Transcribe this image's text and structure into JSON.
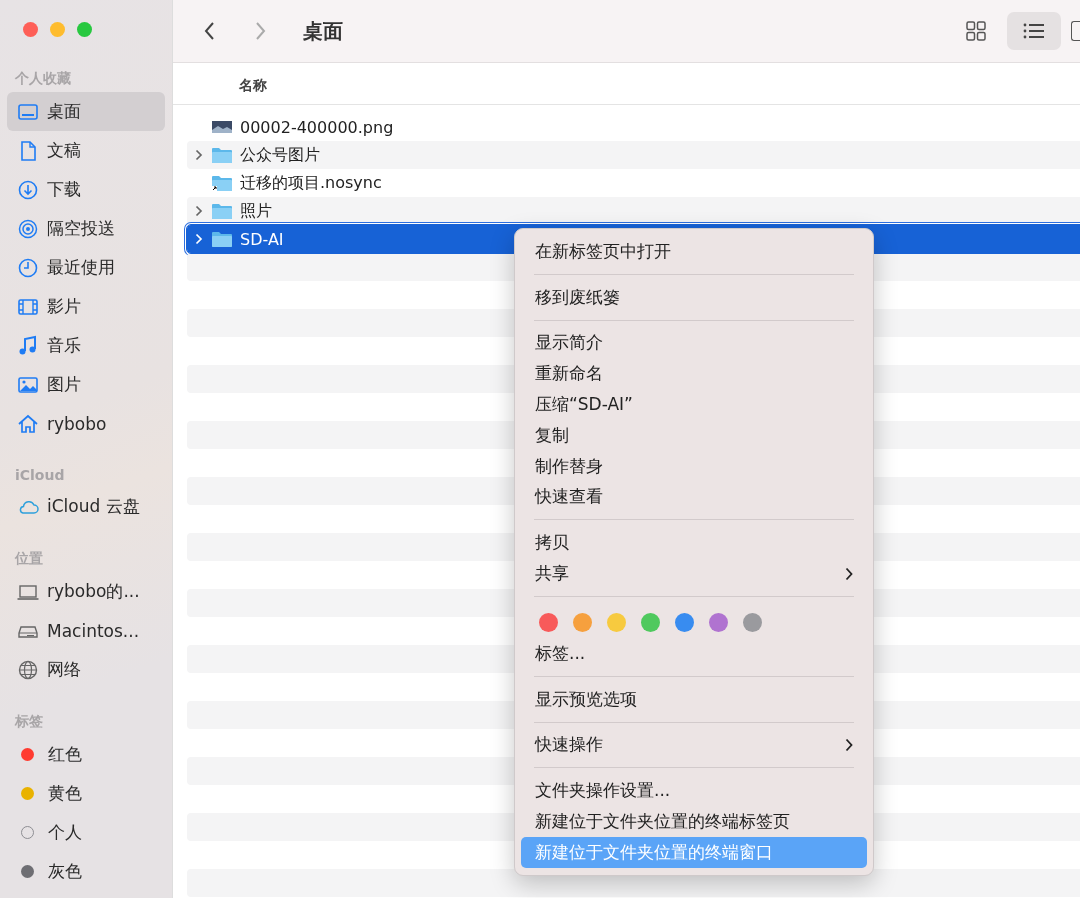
{
  "sidebar": {
    "sections": [
      {
        "title": "个人收藏",
        "items": [
          {
            "label": "桌面",
            "selected": true
          },
          {
            "label": "文稿",
            "selected": false
          },
          {
            "label": "下载",
            "selected": false
          },
          {
            "label": "隔空投送",
            "selected": false
          },
          {
            "label": "最近使用",
            "selected": false
          },
          {
            "label": "影片",
            "selected": false
          },
          {
            "label": "音乐",
            "selected": false
          },
          {
            "label": "图片",
            "selected": false
          },
          {
            "label": "rybobo",
            "selected": false
          }
        ]
      },
      {
        "title": "iCloud",
        "items": [
          {
            "label": "iCloud 云盘",
            "selected": false
          }
        ]
      },
      {
        "title": "位置",
        "items": [
          {
            "label": "rybobo的...",
            "selected": false
          },
          {
            "label": "Macintos...",
            "selected": false
          },
          {
            "label": "网络",
            "selected": false
          }
        ]
      }
    ],
    "tags": {
      "title": "标签",
      "items": [
        {
          "label": "红色",
          "color": "#ff3b30",
          "kind": "filled"
        },
        {
          "label": "黄色",
          "color": "#e9b200",
          "kind": "filled"
        },
        {
          "label": "个人",
          "color": "#8e8e93",
          "kind": "hollow"
        },
        {
          "label": "灰色",
          "color": "#6e6e73",
          "kind": "filled"
        }
      ]
    }
  },
  "toolbar": {
    "title": "桌面",
    "views": [
      {
        "kind": "grid",
        "selected": false
      },
      {
        "kind": "list",
        "selected": true
      }
    ]
  },
  "file_list": {
    "columns": [
      "名称"
    ],
    "rows": [
      {
        "name": "00002-400000.png",
        "kind": "image",
        "expandable": false,
        "selected": false
      },
      {
        "name": "公众号图片",
        "kind": "folder",
        "expandable": true,
        "selected": false
      },
      {
        "name": "迁移的项目.nosync",
        "kind": "alias",
        "expandable": false,
        "selected": false
      },
      {
        "name": "照片",
        "kind": "folder",
        "expandable": true,
        "selected": false
      },
      {
        "name": "SD-AI",
        "kind": "folder",
        "expandable": true,
        "selected": true
      }
    ]
  },
  "context_menu": {
    "items": [
      {
        "kind": "item",
        "label": "在新标签页中打开",
        "submenu": false,
        "selected": false
      },
      {
        "kind": "separator"
      },
      {
        "kind": "item",
        "label": "移到废纸篓",
        "submenu": false,
        "selected": false
      },
      {
        "kind": "separator"
      },
      {
        "kind": "item",
        "label": "显示简介",
        "submenu": false,
        "selected": false
      },
      {
        "kind": "item",
        "label": "重新命名",
        "submenu": false,
        "selected": false
      },
      {
        "kind": "item",
        "label": "压缩“SD-AI”",
        "submenu": false,
        "selected": false
      },
      {
        "kind": "item",
        "label": "复制",
        "submenu": false,
        "selected": false
      },
      {
        "kind": "item",
        "label": "制作替身",
        "submenu": false,
        "selected": false
      },
      {
        "kind": "item",
        "label": "快速查看",
        "submenu": false,
        "selected": false
      },
      {
        "kind": "separator"
      },
      {
        "kind": "item",
        "label": "拷贝",
        "submenu": false,
        "selected": false
      },
      {
        "kind": "item",
        "label": "共享",
        "submenu": true,
        "selected": false
      },
      {
        "kind": "separator"
      },
      {
        "kind": "colors",
        "colors": [
          {
            "color": "#f85a5a"
          },
          {
            "color": "#f6a03e"
          },
          {
            "color": "#f7ca3f"
          },
          {
            "color": "#4fc95e"
          },
          {
            "color": "#388cf0"
          },
          {
            "color": "#b073d0"
          },
          {
            "color": "#9a9a9e"
          }
        ]
      },
      {
        "kind": "item",
        "label": "标签...",
        "submenu": false,
        "selected": false
      },
      {
        "kind": "separator"
      },
      {
        "kind": "item",
        "label": "显示预览选项",
        "submenu": false,
        "selected": false
      },
      {
        "kind": "separator"
      },
      {
        "kind": "item",
        "label": "快速操作",
        "submenu": true,
        "selected": false
      },
      {
        "kind": "separator"
      },
      {
        "kind": "item",
        "label": "文件夹操作设置...",
        "submenu": false,
        "selected": false
      },
      {
        "kind": "item",
        "label": "新建位于文件夹位置的终端标签页",
        "submenu": false,
        "selected": false
      },
      {
        "kind": "item",
        "label": "新建位于文件夹位置的终端窗口",
        "submenu": false,
        "selected": true
      }
    ]
  }
}
